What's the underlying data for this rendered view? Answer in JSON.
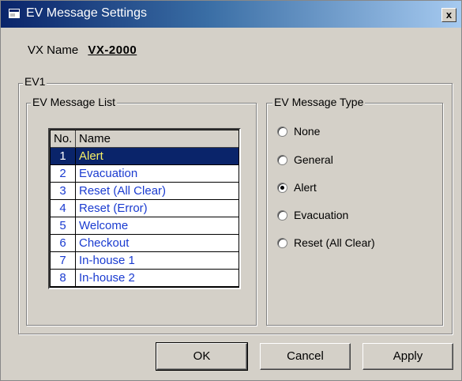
{
  "window": {
    "title": "EV Message Settings",
    "close_label": "x"
  },
  "vx": {
    "label": "VX Name",
    "value": "VX-2000"
  },
  "ev_group": {
    "label": "EV1"
  },
  "message_list": {
    "label": "EV Message List",
    "headers": {
      "no": "No.",
      "name": "Name"
    },
    "rows": [
      {
        "no": "1",
        "name": "Alert"
      },
      {
        "no": "2",
        "name": "Evacuation"
      },
      {
        "no": "3",
        "name": "Reset (All Clear)"
      },
      {
        "no": "4",
        "name": "Reset (Error)"
      },
      {
        "no": "5",
        "name": "Welcome"
      },
      {
        "no": "6",
        "name": "Checkout"
      },
      {
        "no": "7",
        "name": "In-house 1"
      },
      {
        "no": "8",
        "name": "In-house 2"
      }
    ],
    "selected_index": 0
  },
  "message_type": {
    "label": "EV Message Type",
    "options": [
      "None",
      "General",
      "Alert",
      "Evacuation",
      "Reset (All Clear)"
    ],
    "selected": "Alert"
  },
  "buttons": {
    "ok": "OK",
    "cancel": "Cancel",
    "apply": "Apply"
  },
  "colors": {
    "title_start": "#0a246a",
    "selection": "#0a246a",
    "selected_text": "#f7f066",
    "list_text": "#1a3bd0"
  }
}
